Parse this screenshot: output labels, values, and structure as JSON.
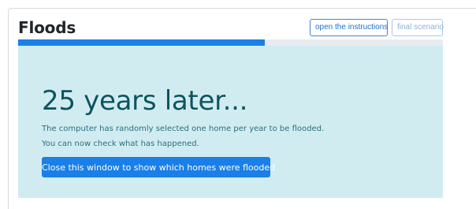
{
  "header": {
    "title": "Floods",
    "instructions_label": "open the instructions",
    "final_label": "final scenario"
  },
  "progress": {
    "fraction": 0.58
  },
  "alert": {
    "heading": "25 years later...",
    "line1": "The computer has randomly selected one home per year to be flooded.",
    "line2": "You can now check what has happened.",
    "button_label": "Close this window to show which homes were flooded"
  },
  "colors": {
    "primary": "#1a7fe8",
    "alert_background": "#d1ecf1",
    "alert_text": "#0c5460"
  }
}
